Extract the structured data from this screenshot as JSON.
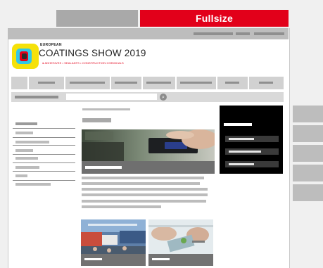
{
  "top_tabs": {
    "fullsize_label": "Fullsize"
  },
  "logo": {
    "small_title": "EUROPEAN",
    "title": "COATINGS SHOW 2019",
    "subtitle": "ADHESIVES • SEALANTS • CONSTRUCTION CHEMICALS"
  },
  "search": {
    "button_icon": "⌕"
  },
  "icons": {
    "search": "magnifier-icon"
  },
  "colors": {
    "accent": "#e2001a",
    "logo_yellow": "#f5e10a",
    "logo_cyan": "#32c7e6"
  }
}
